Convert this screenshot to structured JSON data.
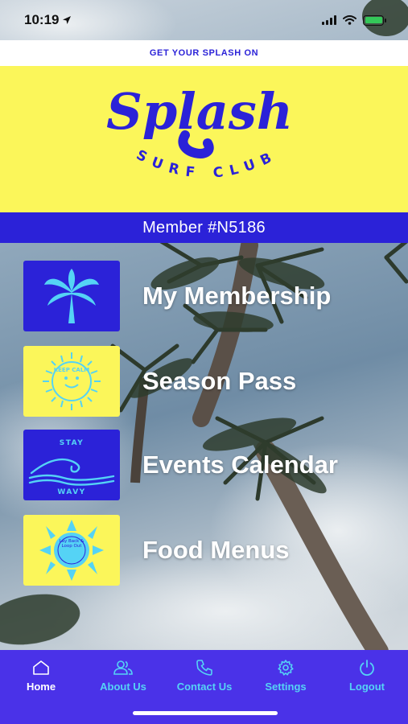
{
  "status_bar": {
    "time": "10:19",
    "location_icon": "location-arrow-icon",
    "icons": [
      "cellular-signal-icon",
      "wifi-icon",
      "battery-charging-icon"
    ]
  },
  "tagline": "GET YOUR SPLASH ON",
  "logo": {
    "wordmark": "Splash",
    "subtitle": "SURF CLUB"
  },
  "member": {
    "label": "Member #N5186"
  },
  "menu": [
    {
      "label": "My Membership",
      "icon": "palm-tree-icon",
      "tile_color": "#2b22d8"
    },
    {
      "label": "Season Pass",
      "icon": "keep-calm-sun-icon",
      "tile_color": "#fbf65a",
      "tile_text": "KEEP CALM"
    },
    {
      "label": "Events Calendar",
      "icon": "stay-wavy-icon",
      "tile_color": "#2b22d8",
      "tile_text_top": "STAY",
      "tile_text_bottom": "WAVY"
    },
    {
      "label": "Food Menus",
      "icon": "lay-back-sun-icon",
      "tile_color": "#fbf65a",
      "tile_text": "Lay Back & Loop Out"
    }
  ],
  "bottom_nav": [
    {
      "label": "Home",
      "icon": "home-icon",
      "active": true
    },
    {
      "label": "About Us",
      "icon": "users-icon",
      "active": false
    },
    {
      "label": "Contact Us",
      "icon": "phone-icon",
      "active": false
    },
    {
      "label": "Settings",
      "icon": "gear-icon",
      "active": false
    },
    {
      "label": "Logout",
      "icon": "power-icon",
      "active": false
    }
  ],
  "colors": {
    "brand_blue": "#2b22d8",
    "brand_yellow": "#fbf65a",
    "nav_blue": "#4a32e8",
    "nav_label_cyan": "#55d3f5",
    "white": "#ffffff"
  }
}
